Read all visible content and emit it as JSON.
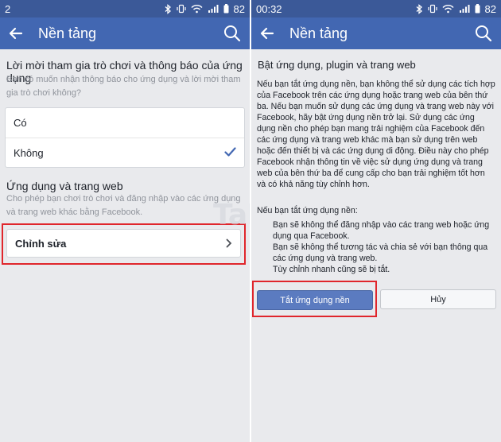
{
  "left": {
    "status": {
      "time": "2",
      "battery": "82"
    },
    "header": {
      "title": "Nền tảng"
    },
    "invites": {
      "title": "Lời mời tham gia trò chơi và thông báo của ứng dụng",
      "subtitle": "Bạn có muốn nhận thông báo cho ứng dụng và lời mời tham gia trò chơi không?",
      "options": [
        {
          "label": "Có",
          "selected": false
        },
        {
          "label": "Không",
          "selected": true
        }
      ]
    },
    "apps": {
      "title": "Ứng dụng và trang web",
      "subtitle": "Cho phép bạn chơi trò chơi và đăng nhập vào các ứng dụng và trang web khác bằng Facebook.",
      "edit_label": "Chỉnh sửa"
    }
  },
  "right": {
    "status": {
      "time": "00:32",
      "battery": "82"
    },
    "header": {
      "title": "Nền tảng"
    },
    "heading": "Bật ứng dụng, plugin và trang web",
    "body": "Nếu bạn tắt ứng dụng nền, bạn không thể sử dụng các tích hợp của Facebook trên các ứng dụng hoặc trang web của bên thứ ba. Nếu bạn muốn sử dụng các ứng dụng và trang web này với Facebook, hãy bật ứng dụng nền trở lại. Sử dụng các ứng dụng nền cho phép bạn mang trải nghiệm của Facebook đến các ứng dụng và trang web khác mà bạn sử dụng trên web hoặc đến thiết bị và các ứng dụng di động. Điều này cho phép Facebook nhận thông tin về việc sử dụng ứng dụng và trang web của bên thứ ba để cung cấp cho bạn trải nghiệm tốt hơn và có khả năng tùy chỉnh hơn.",
    "if_off_label": "Nếu bạn tắt ứng dụng nền:",
    "bullets": [
      "Bạn sẽ không thể đăng nhập vào các trang web hoặc ứng dụng qua Facebook.",
      "Bạn sẽ không thể tương tác và chia sẻ với bạn thông qua các ứng dụng và trang web.",
      "Tùy chỉnh nhanh cũng sẽ bị tắt."
    ],
    "turn_off_label": "Tắt ứng dụng nền",
    "cancel_label": "Hủy"
  },
  "watermark": "TaI",
  "colors": {
    "header": "#4267b2",
    "statusbar": "#3b5998",
    "accent": "#4267b2",
    "highlight": "#e0262c"
  },
  "icons": [
    "back-arrow-icon",
    "search-icon",
    "checkmark-icon",
    "chevron-right-icon",
    "bluetooth-icon",
    "wifi-icon",
    "signal-icon",
    "battery-icon"
  ]
}
